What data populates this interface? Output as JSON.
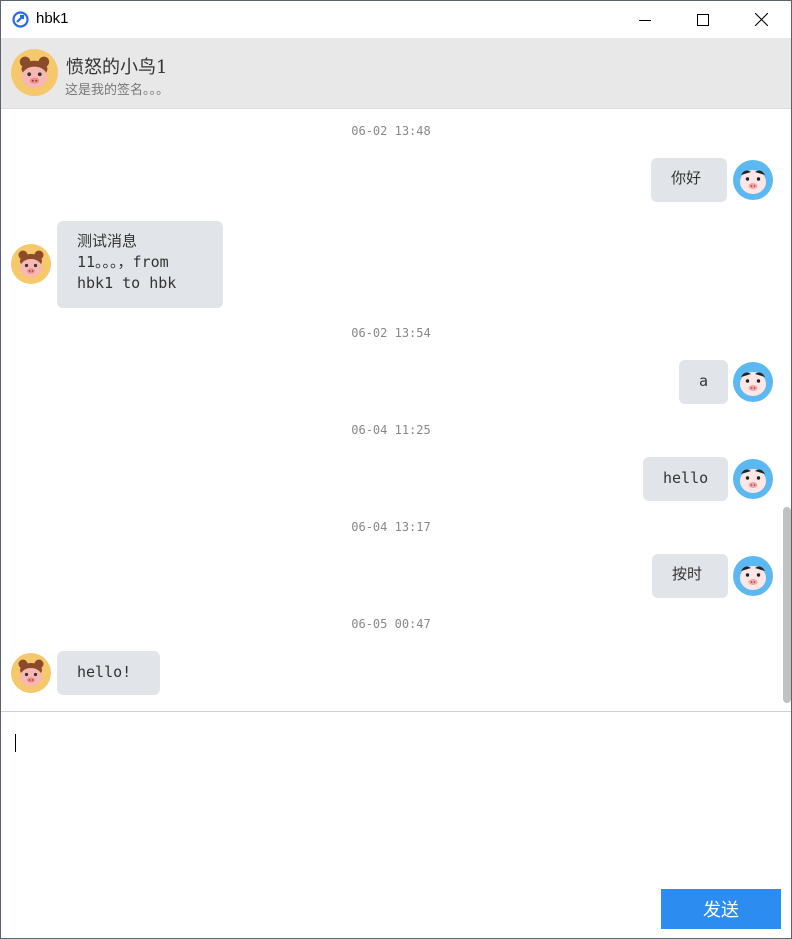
{
  "window": {
    "title": "hbk1",
    "controls": {
      "minimize": "minimize-icon",
      "maximize": "maximize-icon",
      "close": "close-icon"
    }
  },
  "contact": {
    "name": "愤怒的小鸟1",
    "signature": "这是我的签名。。。"
  },
  "messages": [
    {
      "type": "timestamp",
      "text": "06-02 13:48"
    },
    {
      "type": "sent",
      "lines": [
        "你好"
      ]
    },
    {
      "type": "received",
      "lines": [
        "测试消息",
        "11。。。，from",
        "hbk1 to hbk"
      ]
    },
    {
      "type": "timestamp",
      "text": "06-02 13:54"
    },
    {
      "type": "sent",
      "lines": [
        "a"
      ]
    },
    {
      "type": "timestamp",
      "text": "06-04 11:25"
    },
    {
      "type": "sent",
      "lines": [
        "hello"
      ]
    },
    {
      "type": "timestamp",
      "text": "06-04 13:17"
    },
    {
      "type": "sent",
      "lines": [
        "按时"
      ]
    },
    {
      "type": "timestamp",
      "text": "06-05 00:47"
    },
    {
      "type": "received",
      "lines": [
        "hello!"
      ]
    }
  ],
  "composer": {
    "value": "",
    "send_label": "发送"
  },
  "colors": {
    "header_bg": "#e8e8e8",
    "bubble_bg": "#e1e5ea",
    "send_button": "#2d8cf0",
    "contact_avatar_bg": "#f5c96b",
    "self_avatar_bg": "#5cb8f0"
  }
}
